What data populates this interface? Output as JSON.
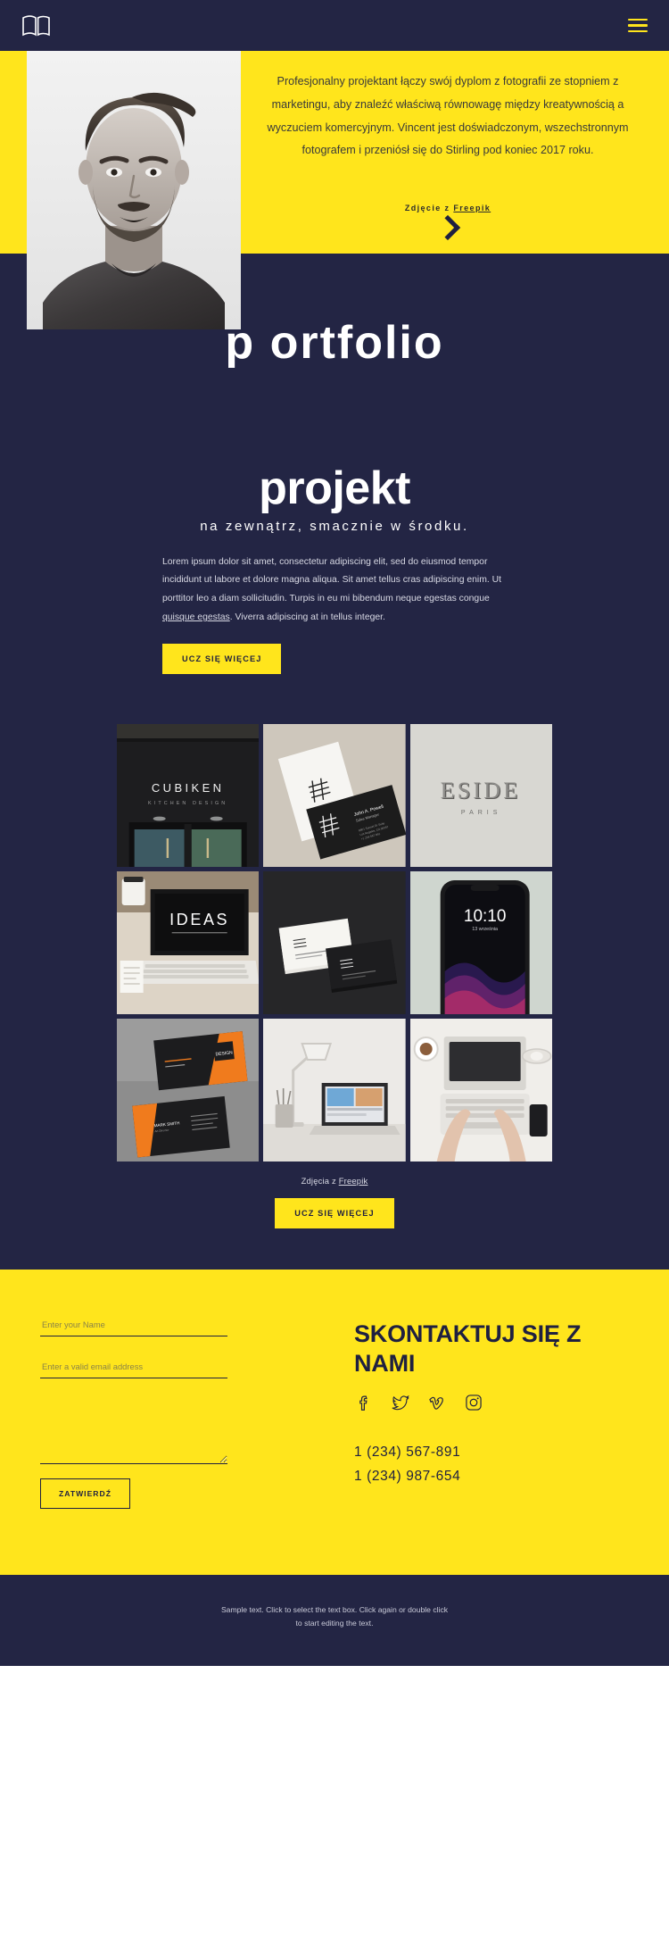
{
  "header": {
    "logo_icon": "open-book-icon",
    "menu_icon": "hamburger-menu-icon",
    "accent_yellow": "#ffe51c",
    "dark_navy": "#232544"
  },
  "hero": {
    "paragraph": "Profesjonalny projektant łączy swój dyplom z fotografii ze stopniem z marketingu, aby znaleźć właściwą równowagę między kreatywnością a wyczuciem komercyjnym. Vincent jest doświadczonym, wszechstronnym fotografem i przeniósł się do Stirling pod koniec 2017 roku.",
    "credit_prefix": "Zdjęcie z ",
    "credit_link": "Freepik",
    "scroll_icon": "chevron-right-icon",
    "portrait_alt": "bearded-man-portrait"
  },
  "portfolio_band": {
    "title": "p ortfolio"
  },
  "projekt": {
    "heading": "projekt",
    "subheading": "na zewnątrz, smacznie w środku.",
    "paragraph_1": "Lorem ipsum dolor sit amet, consectetur adipiscing elit, sed do eiusmod tempor incididunt ut labore et dolore magna aliqua. Sit amet tellus cras adipiscing enim. Ut porttitor leo a diam sollicitudin. Turpis in eu mi bibendum neque egestas congue ",
    "paragraph_link": "quisque egestas",
    "paragraph_2": ". Viverra adipiscing at in tellus integer.",
    "button_label": "UCZ SIĘ WIĘCEJ"
  },
  "gallery": {
    "items": [
      {
        "name": "cubiken-storefront-sign",
        "label": "CUBIKEN",
        "sublabel": "KITCHEN DESIGN"
      },
      {
        "name": "black-white-business-cards",
        "label": "John A. Powell",
        "sublabel": "Sales Manager"
      },
      {
        "name": "eside-paris-embossed-logo",
        "label": "ESIDE",
        "sublabel": "PARIS"
      },
      {
        "name": "laptop-ideas-desk",
        "label": "IDEAS",
        "sublabel": ""
      },
      {
        "name": "stacked-business-cards",
        "label": "",
        "sublabel": ""
      },
      {
        "name": "smartphone-lockscreen-mockup",
        "label": "10:10",
        "sublabel": "13 września"
      },
      {
        "name": "orange-black-business-cards",
        "label": "DESIGN",
        "sublabel": "MARK SMITH"
      },
      {
        "name": "desk-lamp-laptop-workspace",
        "label": "",
        "sublabel": ""
      },
      {
        "name": "hands-typing-laptop-flatlay",
        "label": "",
        "sublabel": ""
      }
    ],
    "caption_prefix": "Zdjęcia z ",
    "caption_link": "Freepik",
    "button_label": "UCZ SIĘ WIĘCEJ"
  },
  "contact": {
    "name_placeholder": "Enter your Name",
    "name_value": "",
    "email_placeholder": "Enter a valid email address",
    "email_value": "",
    "message_placeholder": "",
    "message_value": "",
    "submit_label": "ZATWIERDŹ",
    "heading": "SKONTAKTUJ SIĘ Z NAMI",
    "socials": [
      {
        "name": "facebook-icon"
      },
      {
        "name": "twitter-icon"
      },
      {
        "name": "vimeo-icon"
      },
      {
        "name": "instagram-icon"
      }
    ],
    "phones": [
      "1 (234) 567-891",
      "1 (234) 987-654"
    ]
  },
  "footer": {
    "text": "Sample text. Click to select the text box. Click again or double click to start editing the text."
  }
}
